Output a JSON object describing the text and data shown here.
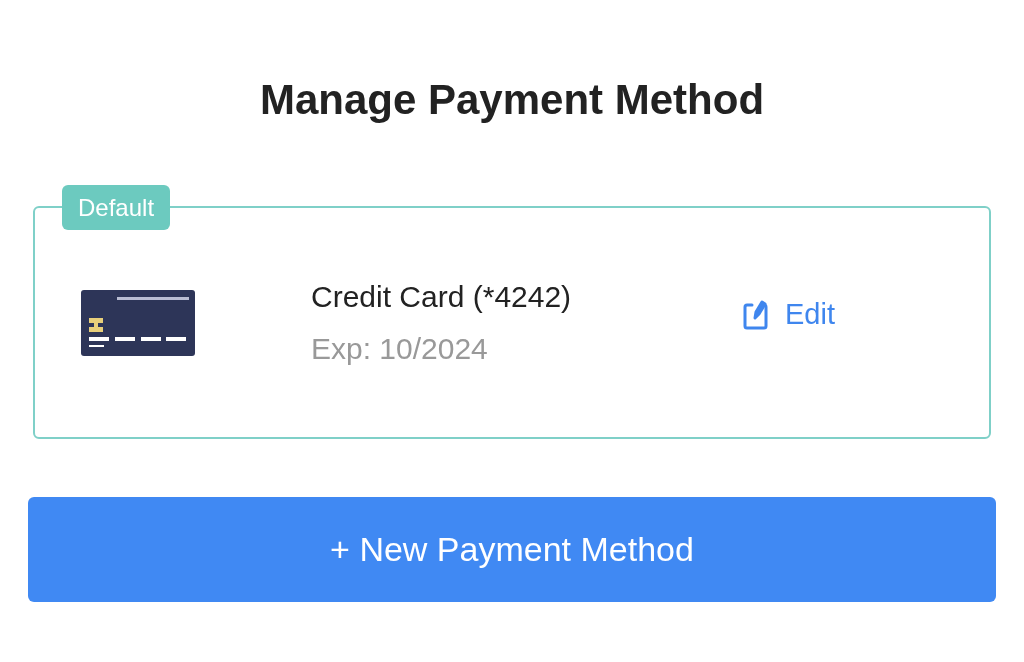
{
  "title": "Manage Payment Method",
  "payment_methods": [
    {
      "badge": "Default",
      "name": "Credit Card (*4242)",
      "expiry": "Exp: 10/2024",
      "edit_label": "Edit"
    }
  ],
  "add_button": "+ New Payment Method"
}
